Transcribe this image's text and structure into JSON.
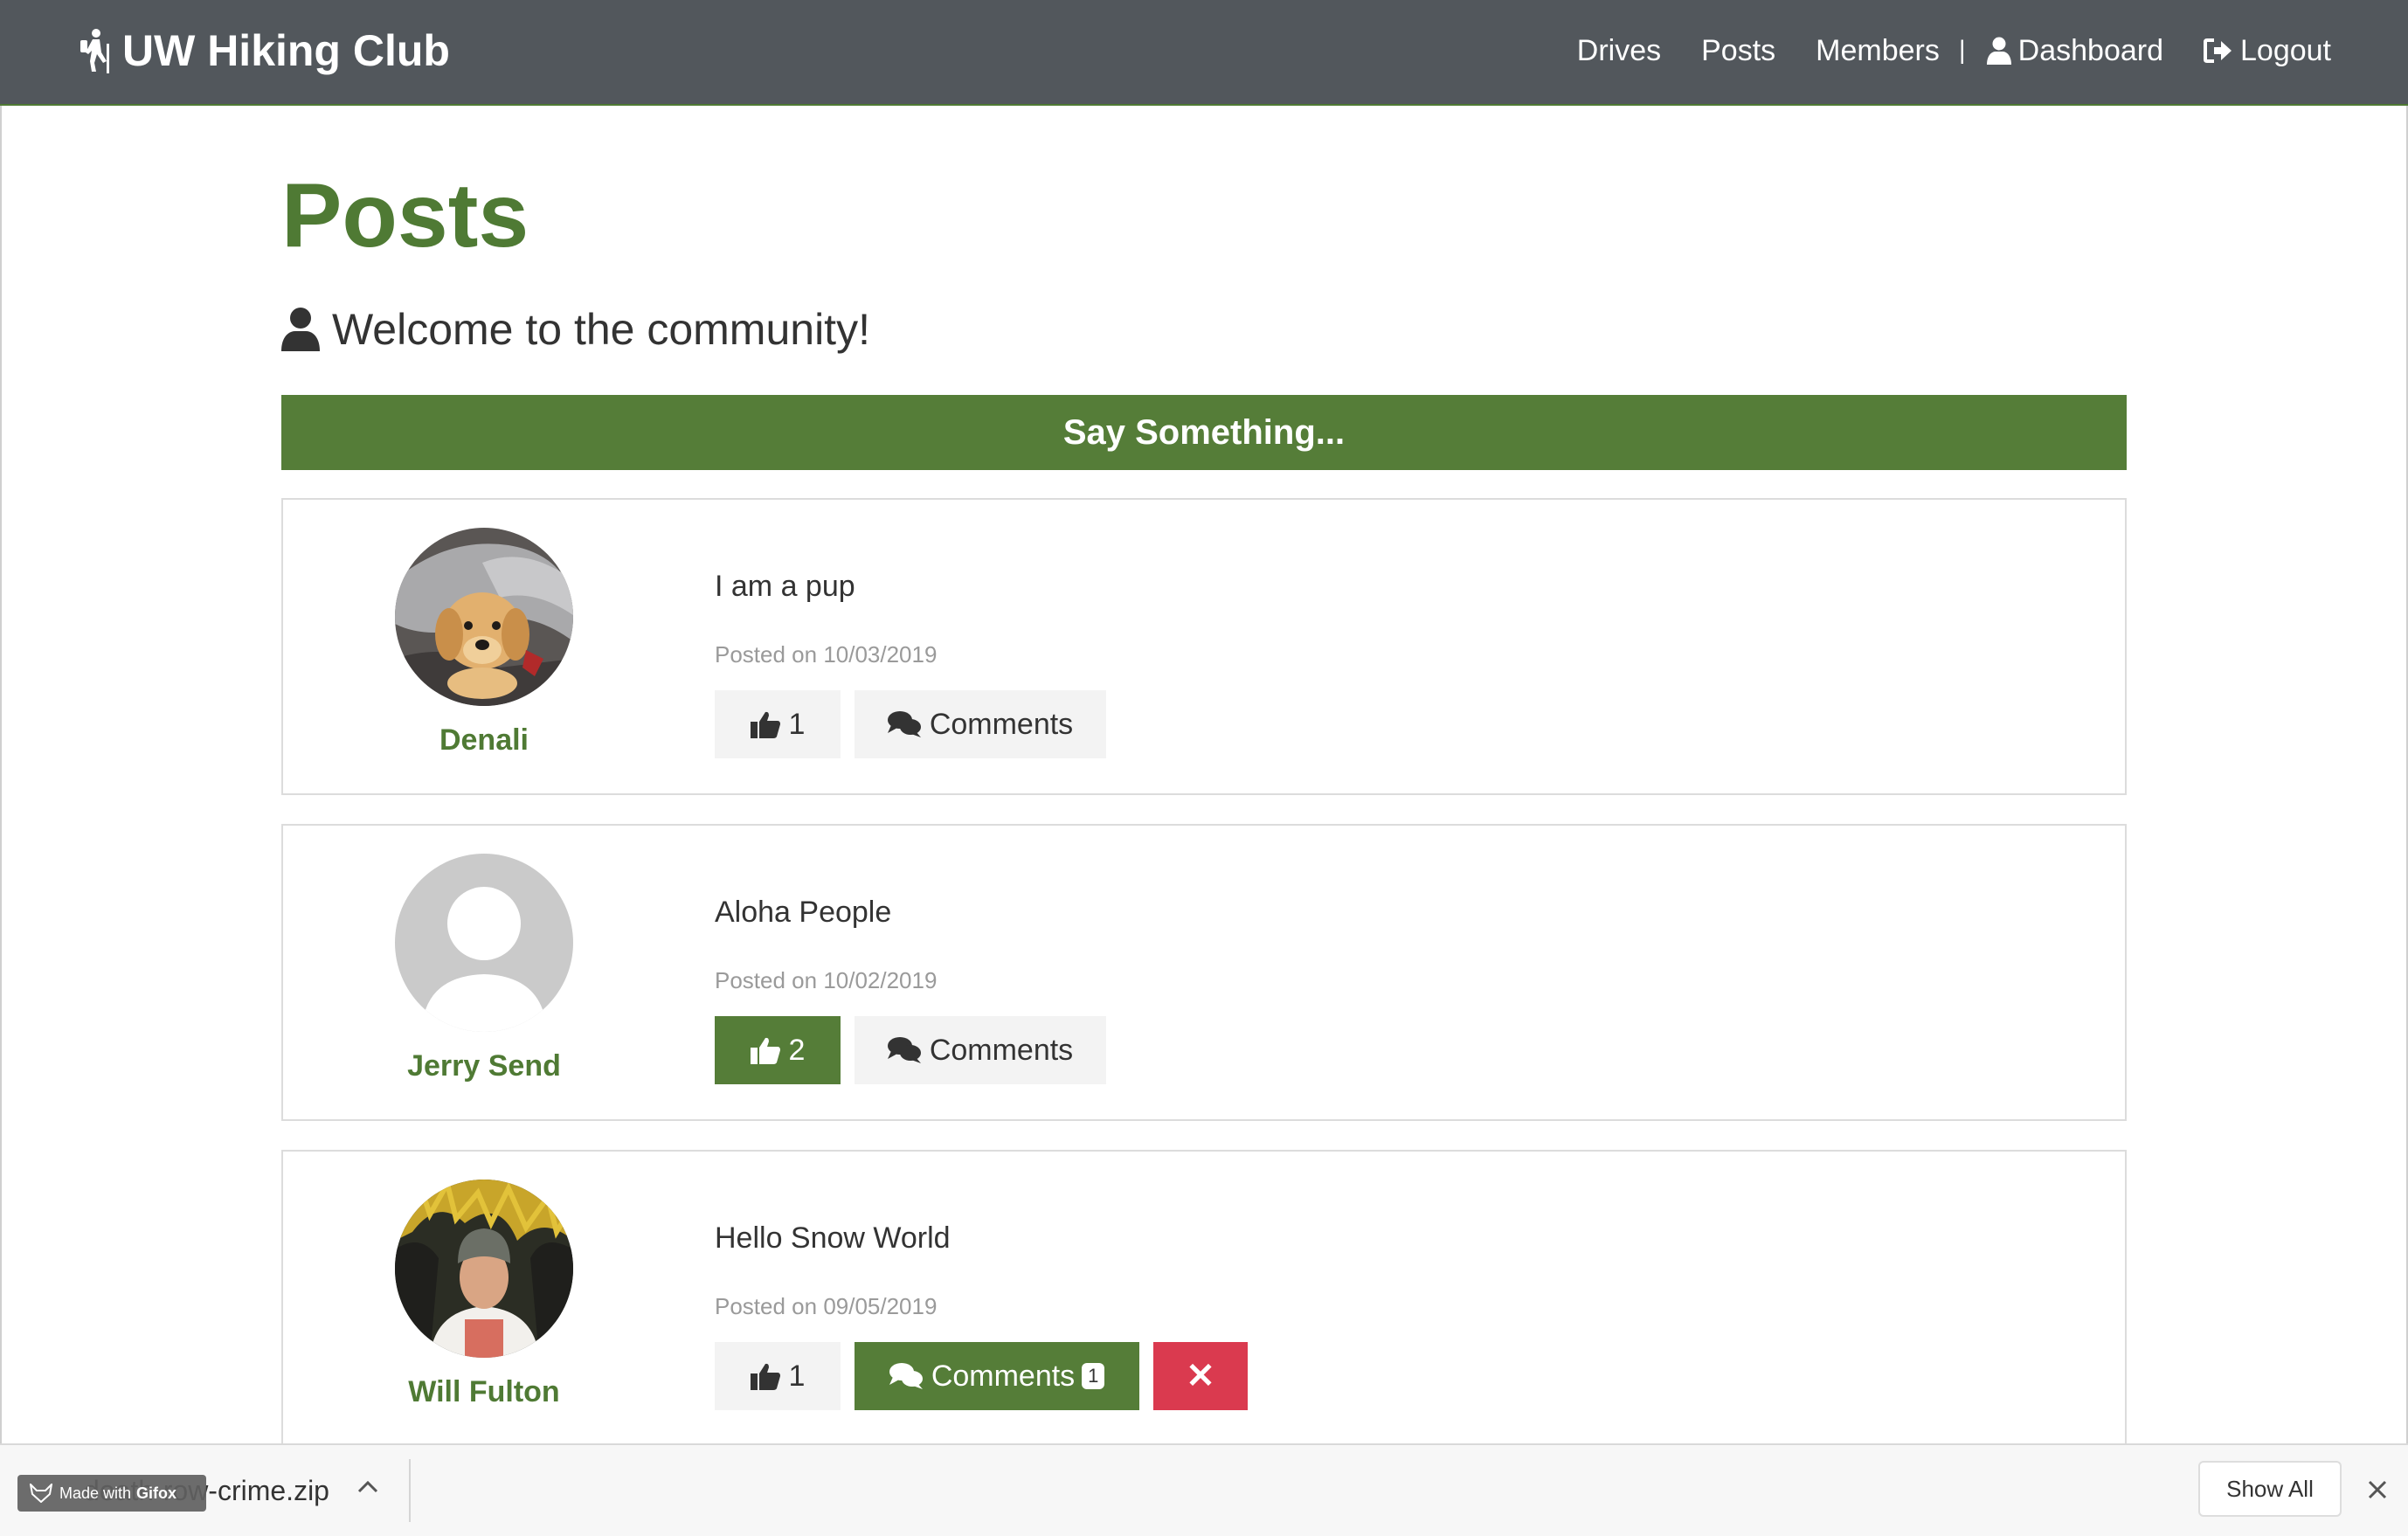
{
  "brand": {
    "name": "UW Hiking Club",
    "icon": "hiker-icon"
  },
  "nav": {
    "drives": "Drives",
    "posts": "Posts",
    "members": "Members",
    "separator": "|",
    "dashboard": "Dashboard",
    "logout": "Logout"
  },
  "page": {
    "title": "Posts",
    "lead": "Welcome to the community!",
    "say_button": "Say Something..."
  },
  "posts": [
    {
      "author": "Denali",
      "text": "I am a pup",
      "date": "Posted on 10/03/2019",
      "likes": "1",
      "liked": false,
      "comments_label": "Comments",
      "avatar": "puppy-photo"
    },
    {
      "author": "Jerry Send",
      "text": "Aloha People",
      "date": "Posted on 10/02/2019",
      "likes": "2",
      "liked": true,
      "comments_label": "Comments",
      "avatar": "default-user-avatar"
    },
    {
      "author": "Will Fulton",
      "text": "Hello Snow World",
      "date": "Posted on 09/05/2019",
      "likes": "1",
      "liked": false,
      "comments_label": "Comments",
      "comments_count": "1",
      "delete_label": "✕",
      "avatar": "man-photo"
    }
  ],
  "download_bar": {
    "file_name": "death-row-crime.zip",
    "made_with": "Made with",
    "made_with_brand": "Gifox",
    "show_all": "Show All"
  },
  "colors": {
    "navbar": "#52575c",
    "accent_green": "#557d38",
    "title_green": "#4f7a34",
    "danger": "#da3a4f"
  }
}
